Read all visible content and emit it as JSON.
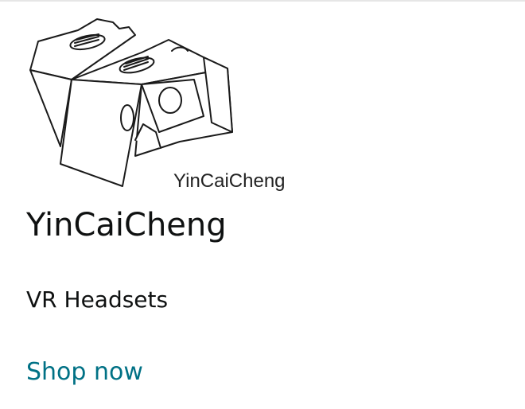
{
  "logo": {
    "icon": "vr-headset-icon",
    "caption": "YinCaiCheng"
  },
  "brand": {
    "name": "YinCaiCheng"
  },
  "category": {
    "label": "VR Headsets"
  },
  "cta": {
    "label": "Shop now",
    "color": "#007185"
  }
}
